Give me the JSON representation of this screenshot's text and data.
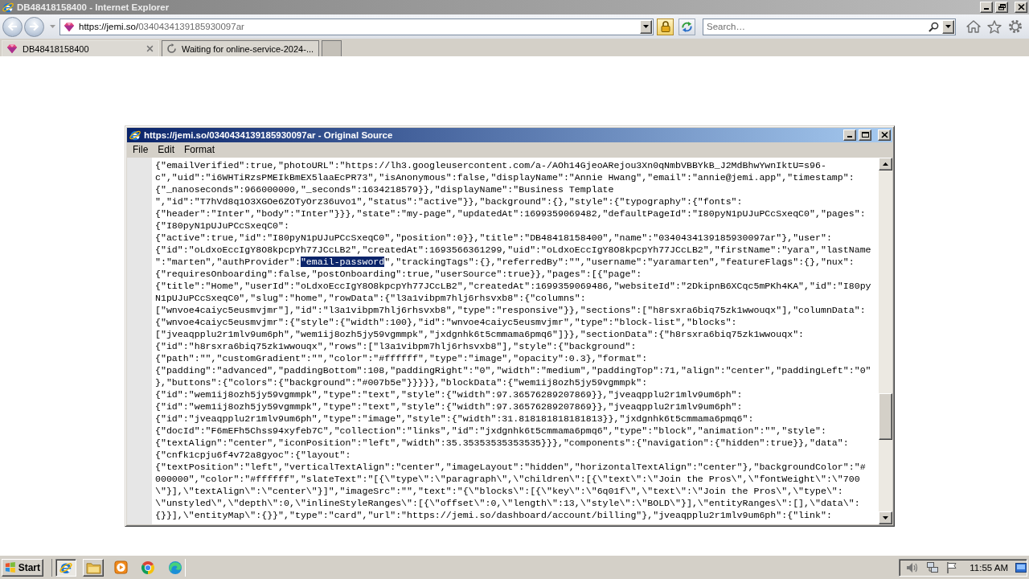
{
  "browser": {
    "title": "DB48418158400 - Internet Explorer",
    "address": {
      "origin": "https://jemi.so/",
      "path": "0340434139185930097ar"
    },
    "search": {
      "placeholder": "Search…"
    },
    "tabs": [
      {
        "label": "DB48418158400",
        "kind": "page",
        "selected": true
      },
      {
        "label": "Waiting for online-service-2024-...",
        "kind": "loading",
        "selected": false
      }
    ]
  },
  "source_window": {
    "title": "https://jemi.so/0340434139185930097ar - Original Source",
    "menu": [
      "File",
      "Edit",
      "Format"
    ],
    "lines": [
      [
        {
          "text": "{\"emailVerified\":true,\"photoURL\":\"https://lh3.googleusercontent.com/a-/AOh14GjeoARejou3Xn0qNmbVBBYkB_J2MdBhwYwnIktU=s96-",
          "selected": false
        }
      ],
      [
        {
          "text": "c\",\"uid\":\"i6WHTiRzsPMEIkBmEX5laaEcPR73\",\"isAnonymous\":false,\"displayName\":\"Annie Hwang\",\"email\":\"annie@jemi.app\",\"timestamp\":",
          "selected": false
        }
      ],
      [
        {
          "text": "{\"_nanoseconds\":966000000,\"_seconds\":1634218579}},\"displayName\":\"Business Template",
          "selected": false
        }
      ],
      [
        {
          "text": "\",\"id\":\"T7hVd8q1O3XGOe6ZOTyOrz36uvo1\",\"status\":\"active\"}},\"background\":{},\"style\":{\"typography\":{\"fonts\":",
          "selected": false
        }
      ],
      [
        {
          "text": "{\"header\":\"Inter\",\"body\":\"Inter\"}}},\"state\":\"my-page\",\"updatedAt\":1699359069482,\"defaultPageId\":\"I80pyN1pUJuPCcSxeqC0\",\"pages\":",
          "selected": false
        }
      ],
      [
        {
          "text": "{\"I80pyN1pUJuPCcSxeqC0\":",
          "selected": false
        }
      ],
      [
        {
          "text": "{\"active\":true,\"id\":\"I80pyN1pUJuPCcSxeqC0\",\"position\":0}},\"title\":\"DB48418158400\",\"name\":\"0340434139185930097ar\"},\"user\":",
          "selected": false
        }
      ],
      [
        {
          "text": "{\"id\":\"oLdxoEccIgY8O8kpcpYh77JCcLB2\",\"createdAt\":1693566361299,\"uid\":\"oLdxoEccIgY8O8kpcpYh77JCcLB2\",\"firstName\":\"yara\",\"lastName",
          "selected": false
        }
      ],
      [
        {
          "text": "\":\"marten\",\"authProvider\":",
          "selected": false
        },
        {
          "text": "\"email-password",
          "selected": true
        },
        {
          "text": "\",\"trackingTags\":{},\"referredBy\":\"\",\"username\":\"yaramarten\",\"featureFlags\":{},\"nux\":",
          "selected": false
        }
      ],
      [
        {
          "text": "{\"requiresOnboarding\":false,\"postOnboarding\":true,\"userSource\":true}},\"pages\":[{\"page\":",
          "selected": false
        }
      ],
      [
        {
          "text": "{\"title\":\"Home\",\"userId\":\"oLdxoEccIgY8O8kpcpYh77JCcLB2\",\"createdAt\":1699359069486,\"websiteId\":\"2DkipnB6XCqc5mPKh4KA\",\"id\":\"I80py",
          "selected": false
        }
      ],
      [
        {
          "text": "N1pUJuPCcSxeqC0\",\"slug\":\"home\",\"rowData\":{\"l3a1vibpm7hlj6rhsvxb8\":{\"columns\":",
          "selected": false
        }
      ],
      [
        {
          "text": "[\"wnvoe4caiyc5eusmvjmr\"],\"id\":\"l3a1vibpm7hlj6rhsvxb8\",\"type\":\"responsive\"}},\"sections\":[\"h8rsxra6biq75zk1wwouqx\"],\"columnData\":",
          "selected": false
        }
      ],
      [
        {
          "text": "{\"wnvoe4caiyc5eusmvjmr\":{\"style\":{\"width\":100},\"id\":\"wnvoe4caiyc5eusmvjmr\",\"type\":\"block-list\",\"blocks\":",
          "selected": false
        }
      ],
      [
        {
          "text": "[\"jveaqpplu2r1mlv9um6ph\",\"wem1ij8ozh5jy59vgmmpk\",\"jxdgnhk6t5cmmama6pmq6\"]}},\"sectionData\":{\"h8rsxra6biq75zk1wwouqx\":",
          "selected": false
        }
      ],
      [
        {
          "text": "{\"id\":\"h8rsxra6biq75zk1wwouqx\",\"rows\":[\"l3a1vibpm7hlj6rhsvxb8\"],\"style\":{\"background\":",
          "selected": false
        }
      ],
      [
        {
          "text": "{\"path\":\"\",\"customGradient\":\"\",\"color\":\"#ffffff\",\"type\":\"image\",\"opacity\":0.3},\"format\":",
          "selected": false
        }
      ],
      [
        {
          "text": "{\"padding\":\"advanced\",\"paddingBottom\":108,\"paddingRight\":\"0\",\"width\":\"medium\",\"paddingTop\":71,\"align\":\"center\",\"paddingLeft\":\"0\"",
          "selected": false
        }
      ],
      [
        {
          "text": "},\"buttons\":{\"colors\":{\"background\":\"#007b5e\"}}}}},\"blockData\":{\"wem1ij8ozh5jy59vgmmpk\":",
          "selected": false
        }
      ],
      [
        {
          "text": "{\"id\":\"wem1ij8ozh5jy59vgmmpk\",\"type\":\"text\",\"style\":{\"width\":97.36576289207869}},\"jveaqpplu2r1mlv9um6ph\":",
          "selected": false
        }
      ],
      [
        {
          "text": "{\"id\":\"wem1ij8ozh5jy59vgmmpk\",\"type\":\"text\",\"style\":{\"width\":97.36576289207869}},\"jveaqpplu2r1mlv9um6ph\":",
          "selected": false
        }
      ],
      [
        {
          "text": "{\"id\":\"jveaqpplu2r1mlv9um6ph\",\"type\":\"image\",\"style\":{\"width\":31.818181818181813}},\"jxdgnhk6t5cmmama6pmq6\":",
          "selected": false
        }
      ],
      [
        {
          "text": "{\"docId\":\"F6mEFh5Chss94xyfeb7C\",\"collection\":\"links\",\"id\":\"jxdgnhk6t5cmmama6pmq6\",\"type\":\"block\",\"animation\":\"\",\"style\":",
          "selected": false
        }
      ],
      [
        {
          "text": "{\"textAlign\":\"center\",\"iconPosition\":\"left\",\"width\":35.35353535353535}}},\"components\":{\"navigation\":{\"hidden\":true}},\"data\":",
          "selected": false
        }
      ],
      [
        {
          "text": "{\"cnfk1cpju6f4v72a8gyoc\":{\"layout\":",
          "selected": false
        }
      ],
      [
        {
          "text": "{\"textPosition\":\"left\",\"verticalTextAlign\":\"center\",\"imageLayout\":\"hidden\",\"horizontalTextAlign\":\"center\"},\"backgroundColor\":\"#",
          "selected": false
        }
      ],
      [
        {
          "text": "000000\",\"color\":\"#ffffff\",\"slateText\":\"[{\\\"type\\\":\\\"paragraph\\\",\\\"children\\\":[{\\\"text\\\":\\\"Join the Pros\\\",\\\"fontWeight\\\":\\\"700",
          "selected": false
        }
      ],
      [
        {
          "text": "\\\"}],\\\"textAlign\\\":\\\"center\\\"}]\",\"imageSrc\":\"\",\"text\":\"{\\\"blocks\\\":[{\\\"key\\\":\\\"6q01f\\\",\\\"text\\\":\\\"Join the Pros\\\",\\\"type\\\":",
          "selected": false
        }
      ],
      [
        {
          "text": "\\\"unstyled\\\",\\\"depth\\\":0,\\\"inlineStyleRanges\\\":[{\\\"offset\\\":0,\\\"length\\\":13,\\\"style\\\":\\\"BOLD\\\"}],\\\"entityRanges\\\":[],\\\"data\\\":",
          "selected": false
        }
      ],
      [
        {
          "text": "{}}],\\\"entityMap\\\":{}}\",\"type\":\"card\",\"url\":\"https://jemi.so/dashboard/account/billing\"},\"jveaqpplu2r1mlv9um6ph\":{\"link\":",
          "selected": false
        }
      ]
    ]
  },
  "taskbar": {
    "start": "Start",
    "apps": [
      {
        "kind": "internet-explorer",
        "running": true,
        "selected": true
      },
      {
        "kind": "file-explorer",
        "running": true,
        "selected": false
      },
      {
        "kind": "media-player",
        "running": false,
        "selected": false
      },
      {
        "kind": "chrome",
        "running": false,
        "selected": false
      },
      {
        "kind": "edge",
        "running": false,
        "selected": false
      }
    ],
    "clock": "11:55 AM"
  }
}
